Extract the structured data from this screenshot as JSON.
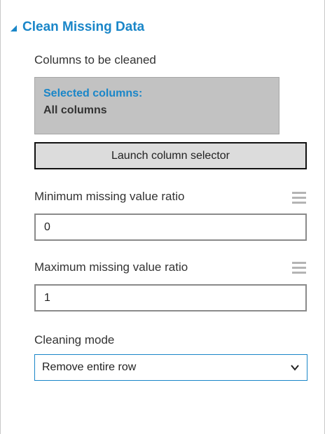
{
  "section": {
    "title": "Clean Missing Data"
  },
  "columns": {
    "label": "Columns to be cleaned",
    "selected_title": "Selected columns:",
    "selected_value": "All columns",
    "launch_button": "Launch column selector"
  },
  "min_ratio": {
    "label": "Minimum missing value ratio",
    "value": "0"
  },
  "max_ratio": {
    "label": "Maximum missing value ratio",
    "value": "1"
  },
  "cleaning_mode": {
    "label": "Cleaning mode",
    "selected": "Remove entire row"
  },
  "colors": {
    "accent": "#1a86c8",
    "selected_box_bg": "#c2c2c2"
  }
}
